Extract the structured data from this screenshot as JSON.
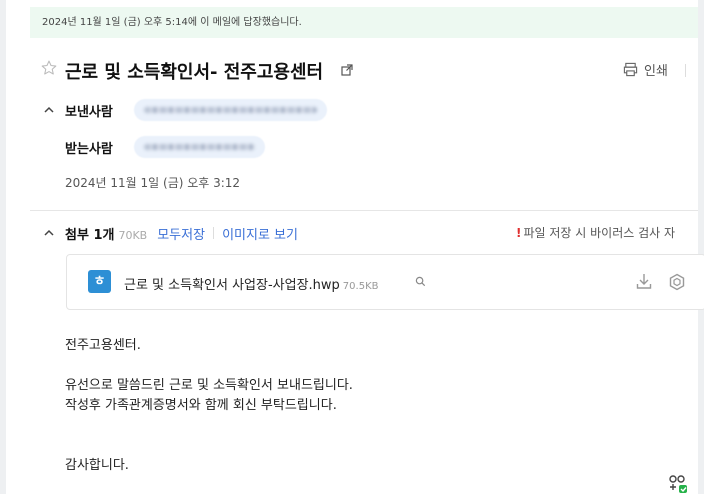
{
  "reply_notice": "2024년 11월 1일 (금) 오후 5:14에 이 메일에 답장했습니다.",
  "subject": "근로 및 소득확인서- 전주고용센터",
  "toolbar": {
    "print_label": "인쇄"
  },
  "sender": {
    "label": "보낸사람"
  },
  "recipient": {
    "label": "받는사람"
  },
  "sent_date": "2024년 11월 1일 (금) 오후 3:12",
  "attachments": {
    "title": "첨부 1개",
    "total_size": "70KB",
    "save_all": "모두저장",
    "view_as_image": "이미지로 보기",
    "warning": "파일 저장 시 바이러스 검사 자",
    "files": [
      {
        "name": "근로 및 소득확인서 사업장-사업장.hwp",
        "size": "70.5KB",
        "icon_letter": "ㅎ"
      }
    ]
  },
  "body": {
    "lines": [
      "전주고용센터.",
      "유선으로 말씀드린 근로 및 소득확인서 보내드립니다.",
      "작성후 가족관계증명서와 함께 회신 부탁드립니다.",
      "감사합니다."
    ]
  },
  "colors": {
    "notice_bg": "#edf9f1",
    "link": "#3a6fd6",
    "warning": "#e03030",
    "hwp_icon": "#2d8fd5"
  }
}
